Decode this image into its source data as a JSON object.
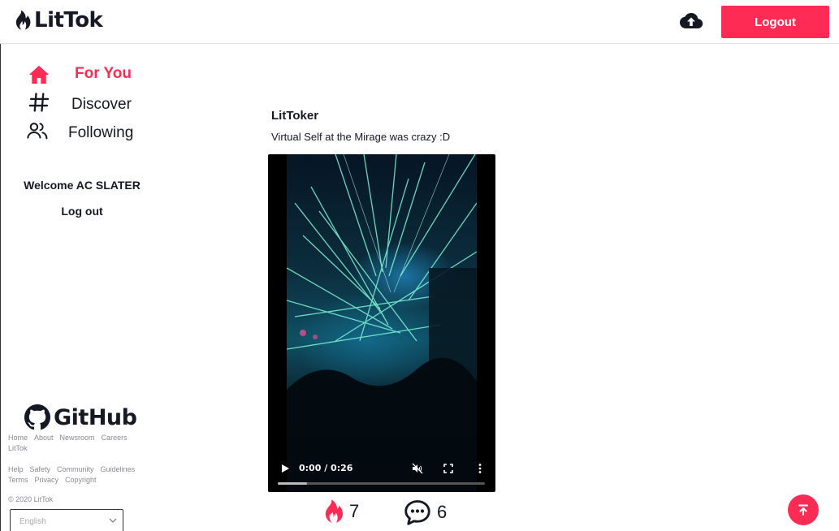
{
  "app": {
    "name": "LitTok"
  },
  "header": {
    "logout_label": "Logout"
  },
  "sidebar": {
    "nav": [
      {
        "label": "For You",
        "icon": "home-icon",
        "active": true
      },
      {
        "label": "Discover",
        "icon": "hashtag-icon",
        "active": false
      },
      {
        "label": "Following",
        "icon": "users-icon",
        "active": false
      }
    ],
    "welcome": "Welcome AC SLATER",
    "logout_link": "Log out",
    "github_label": "GitHub",
    "footer_row1": [
      "Home",
      "About",
      "Newsroom",
      "Careers",
      "LitTok"
    ],
    "footer_row2": [
      "Help",
      "Safety",
      "Community",
      "Guidelines",
      "Terms",
      "Privacy",
      "Copyright"
    ],
    "copyright": "© 2020 LitTok",
    "language": "English"
  },
  "post": {
    "author": "LitToker",
    "caption": "Virtual Self at the Mirage was crazy :D",
    "video": {
      "time": "0:00 / 0:26",
      "progress": 0.14
    },
    "likes": "7",
    "comments": "6"
  },
  "colors": {
    "accent": "#fe2c55",
    "text": "#161823",
    "muted": "#8a8b91"
  }
}
